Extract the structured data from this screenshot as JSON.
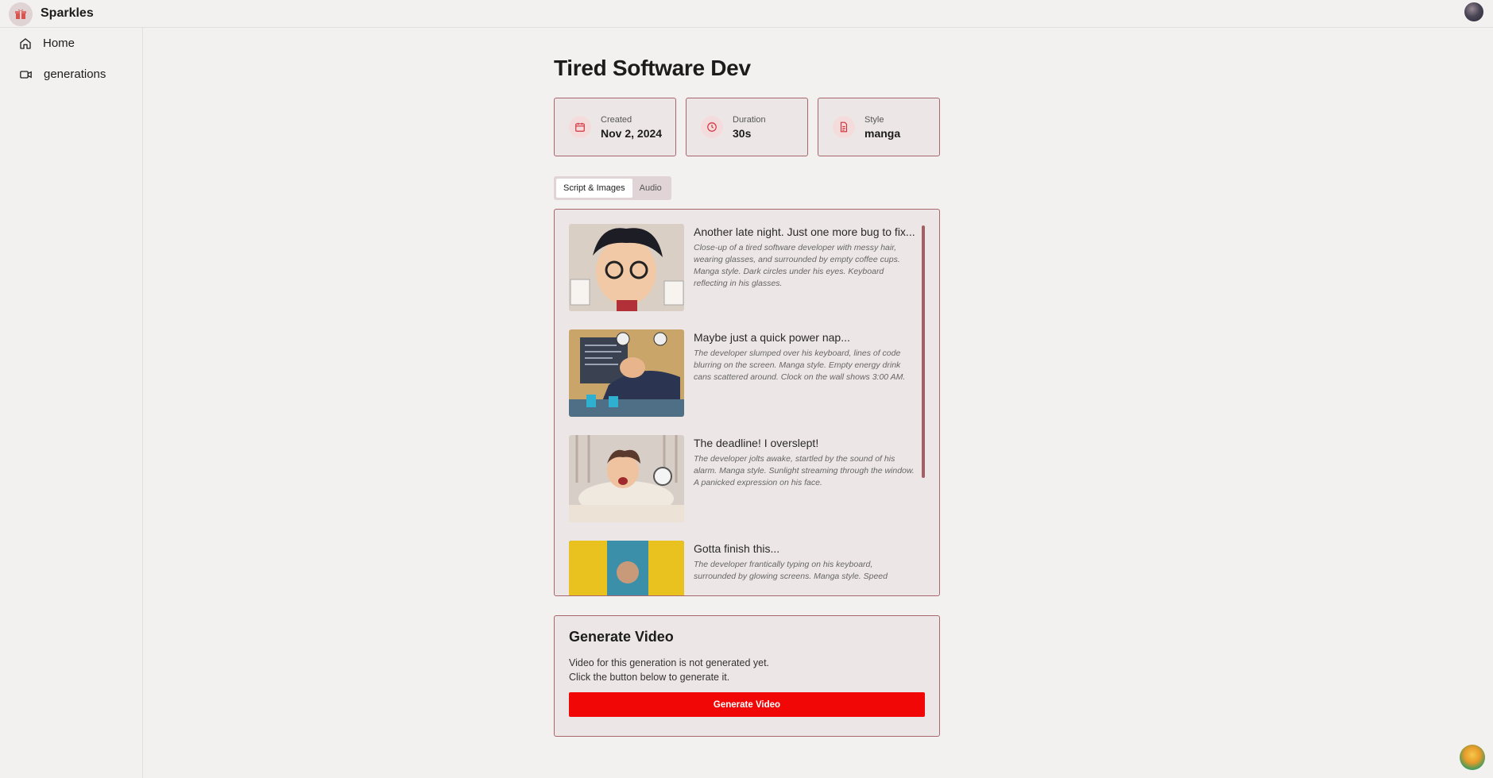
{
  "app": {
    "title": "Sparkles"
  },
  "sidebar": {
    "items": [
      {
        "label": "Home",
        "icon": "home-icon"
      },
      {
        "label": "generations",
        "icon": "video-icon"
      }
    ]
  },
  "page": {
    "title": "Tired Software Dev"
  },
  "meta": [
    {
      "label": "Created",
      "value": "Nov 2, 2024",
      "icon": "calendar-icon"
    },
    {
      "label": "Duration",
      "value": "30s",
      "icon": "clock-icon"
    },
    {
      "label": "Style",
      "value": "manga",
      "icon": "document-icon"
    }
  ],
  "tabs": [
    {
      "label": "Script & Images",
      "active": true
    },
    {
      "label": "Audio",
      "active": false
    }
  ],
  "scenes": [
    {
      "title": "Another late night. Just one more bug to fix...",
      "description": "Close-up of a tired software developer with messy hair, wearing glasses, and surrounded by empty coffee cups. Manga style. Dark circles under his eyes. Keyboard reflecting in his glasses."
    },
    {
      "title": "Maybe just a quick power nap...",
      "description": "The developer slumped over his keyboard, lines of code blurring on the screen. Manga style. Empty energy drink cans scattered around. Clock on the wall shows 3:00 AM."
    },
    {
      "title": "The deadline! I overslept!",
      "description": "The developer jolts awake, startled by the sound of his alarm. Manga style. Sunlight streaming through the window. A panicked expression on his face."
    },
    {
      "title": "Gotta finish this...",
      "description": "The developer frantically typing on his keyboard, surrounded by glowing screens. Manga style. Speed"
    }
  ],
  "generate": {
    "title": "Generate Video",
    "line1": "Video for this generation is not generated yet.",
    "line2": "Click the button below to generate it.",
    "button": "Generate Video"
  },
  "colors": {
    "accent": "#f20707",
    "border": "#a9656c",
    "card_bg": "#ede6e6",
    "page_bg": "#f3f1f0"
  }
}
